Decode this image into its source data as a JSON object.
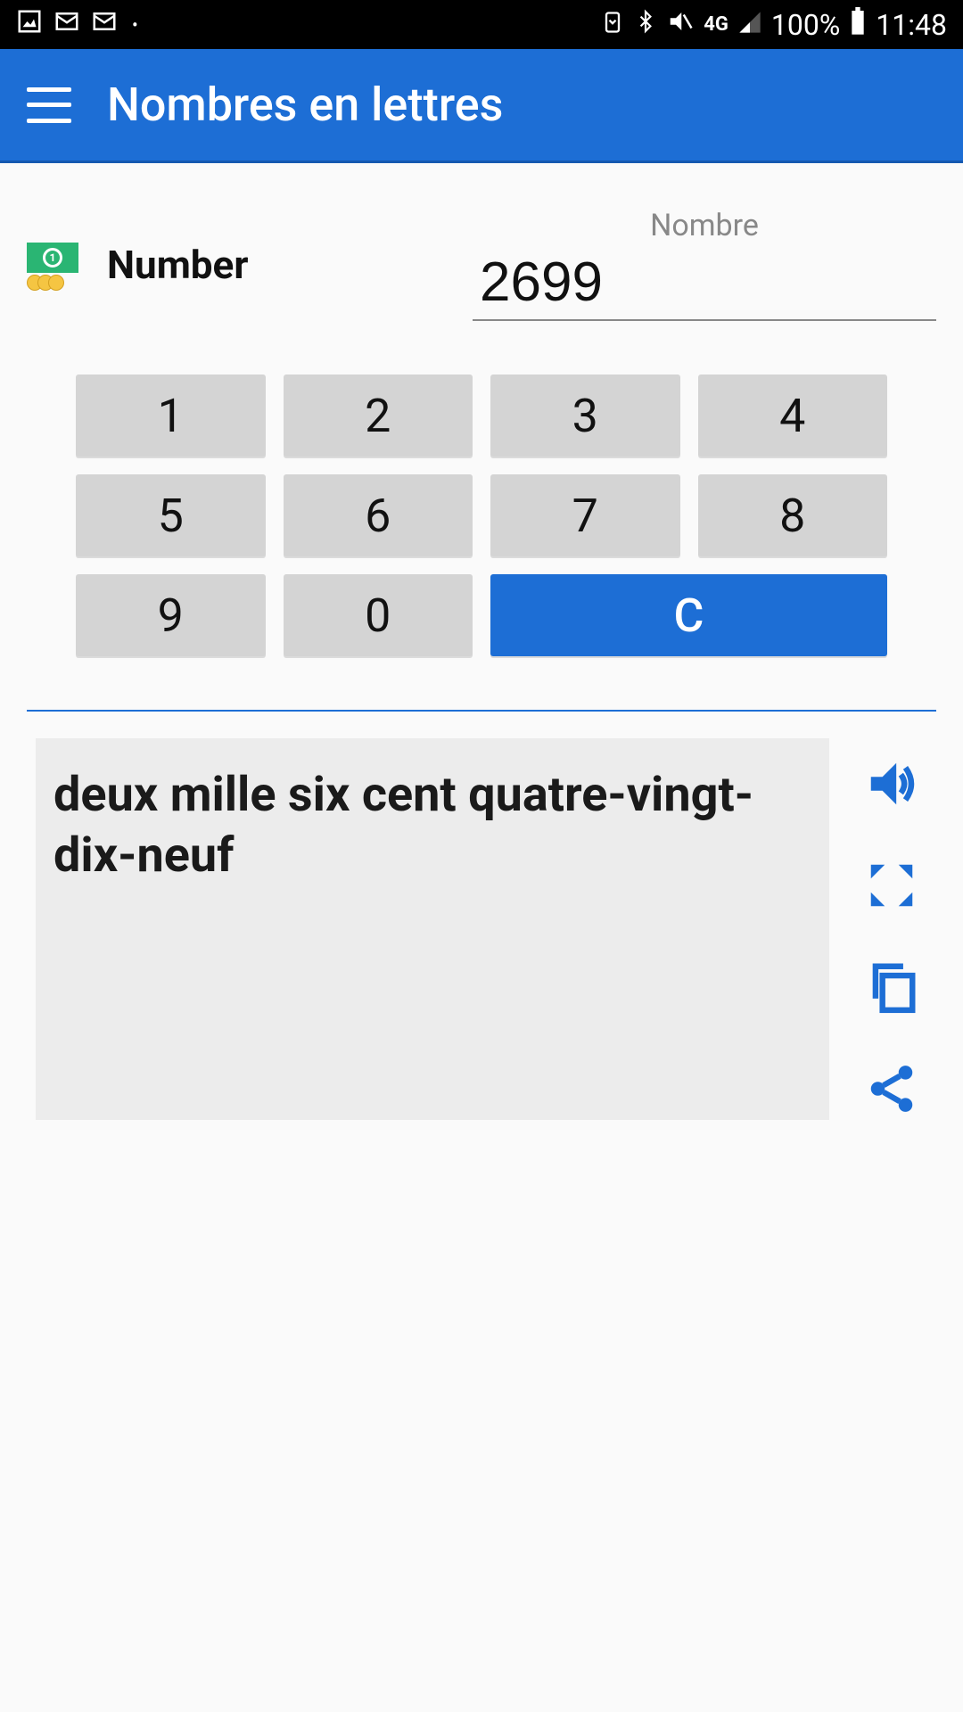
{
  "status": {
    "network_label": "4G",
    "battery_pct": "100%",
    "time": "11:48"
  },
  "appbar": {
    "title": "Nombres en lettres"
  },
  "input": {
    "icon_label": "money-icon",
    "label": "Number",
    "hint": "Nombre",
    "value": "2699"
  },
  "keypad": {
    "keys": [
      "1",
      "2",
      "3",
      "4",
      "5",
      "6",
      "7",
      "8",
      "9",
      "0"
    ],
    "clear_label": "C"
  },
  "result": {
    "text": "deux mille six cent quatre-vingt-dix-neuf"
  },
  "actions": {
    "speak": "speak-icon",
    "fullscreen": "fullscreen-icon",
    "copy": "copy-icon",
    "share": "share-icon"
  },
  "colors": {
    "accent": "#1d6ed5"
  }
}
